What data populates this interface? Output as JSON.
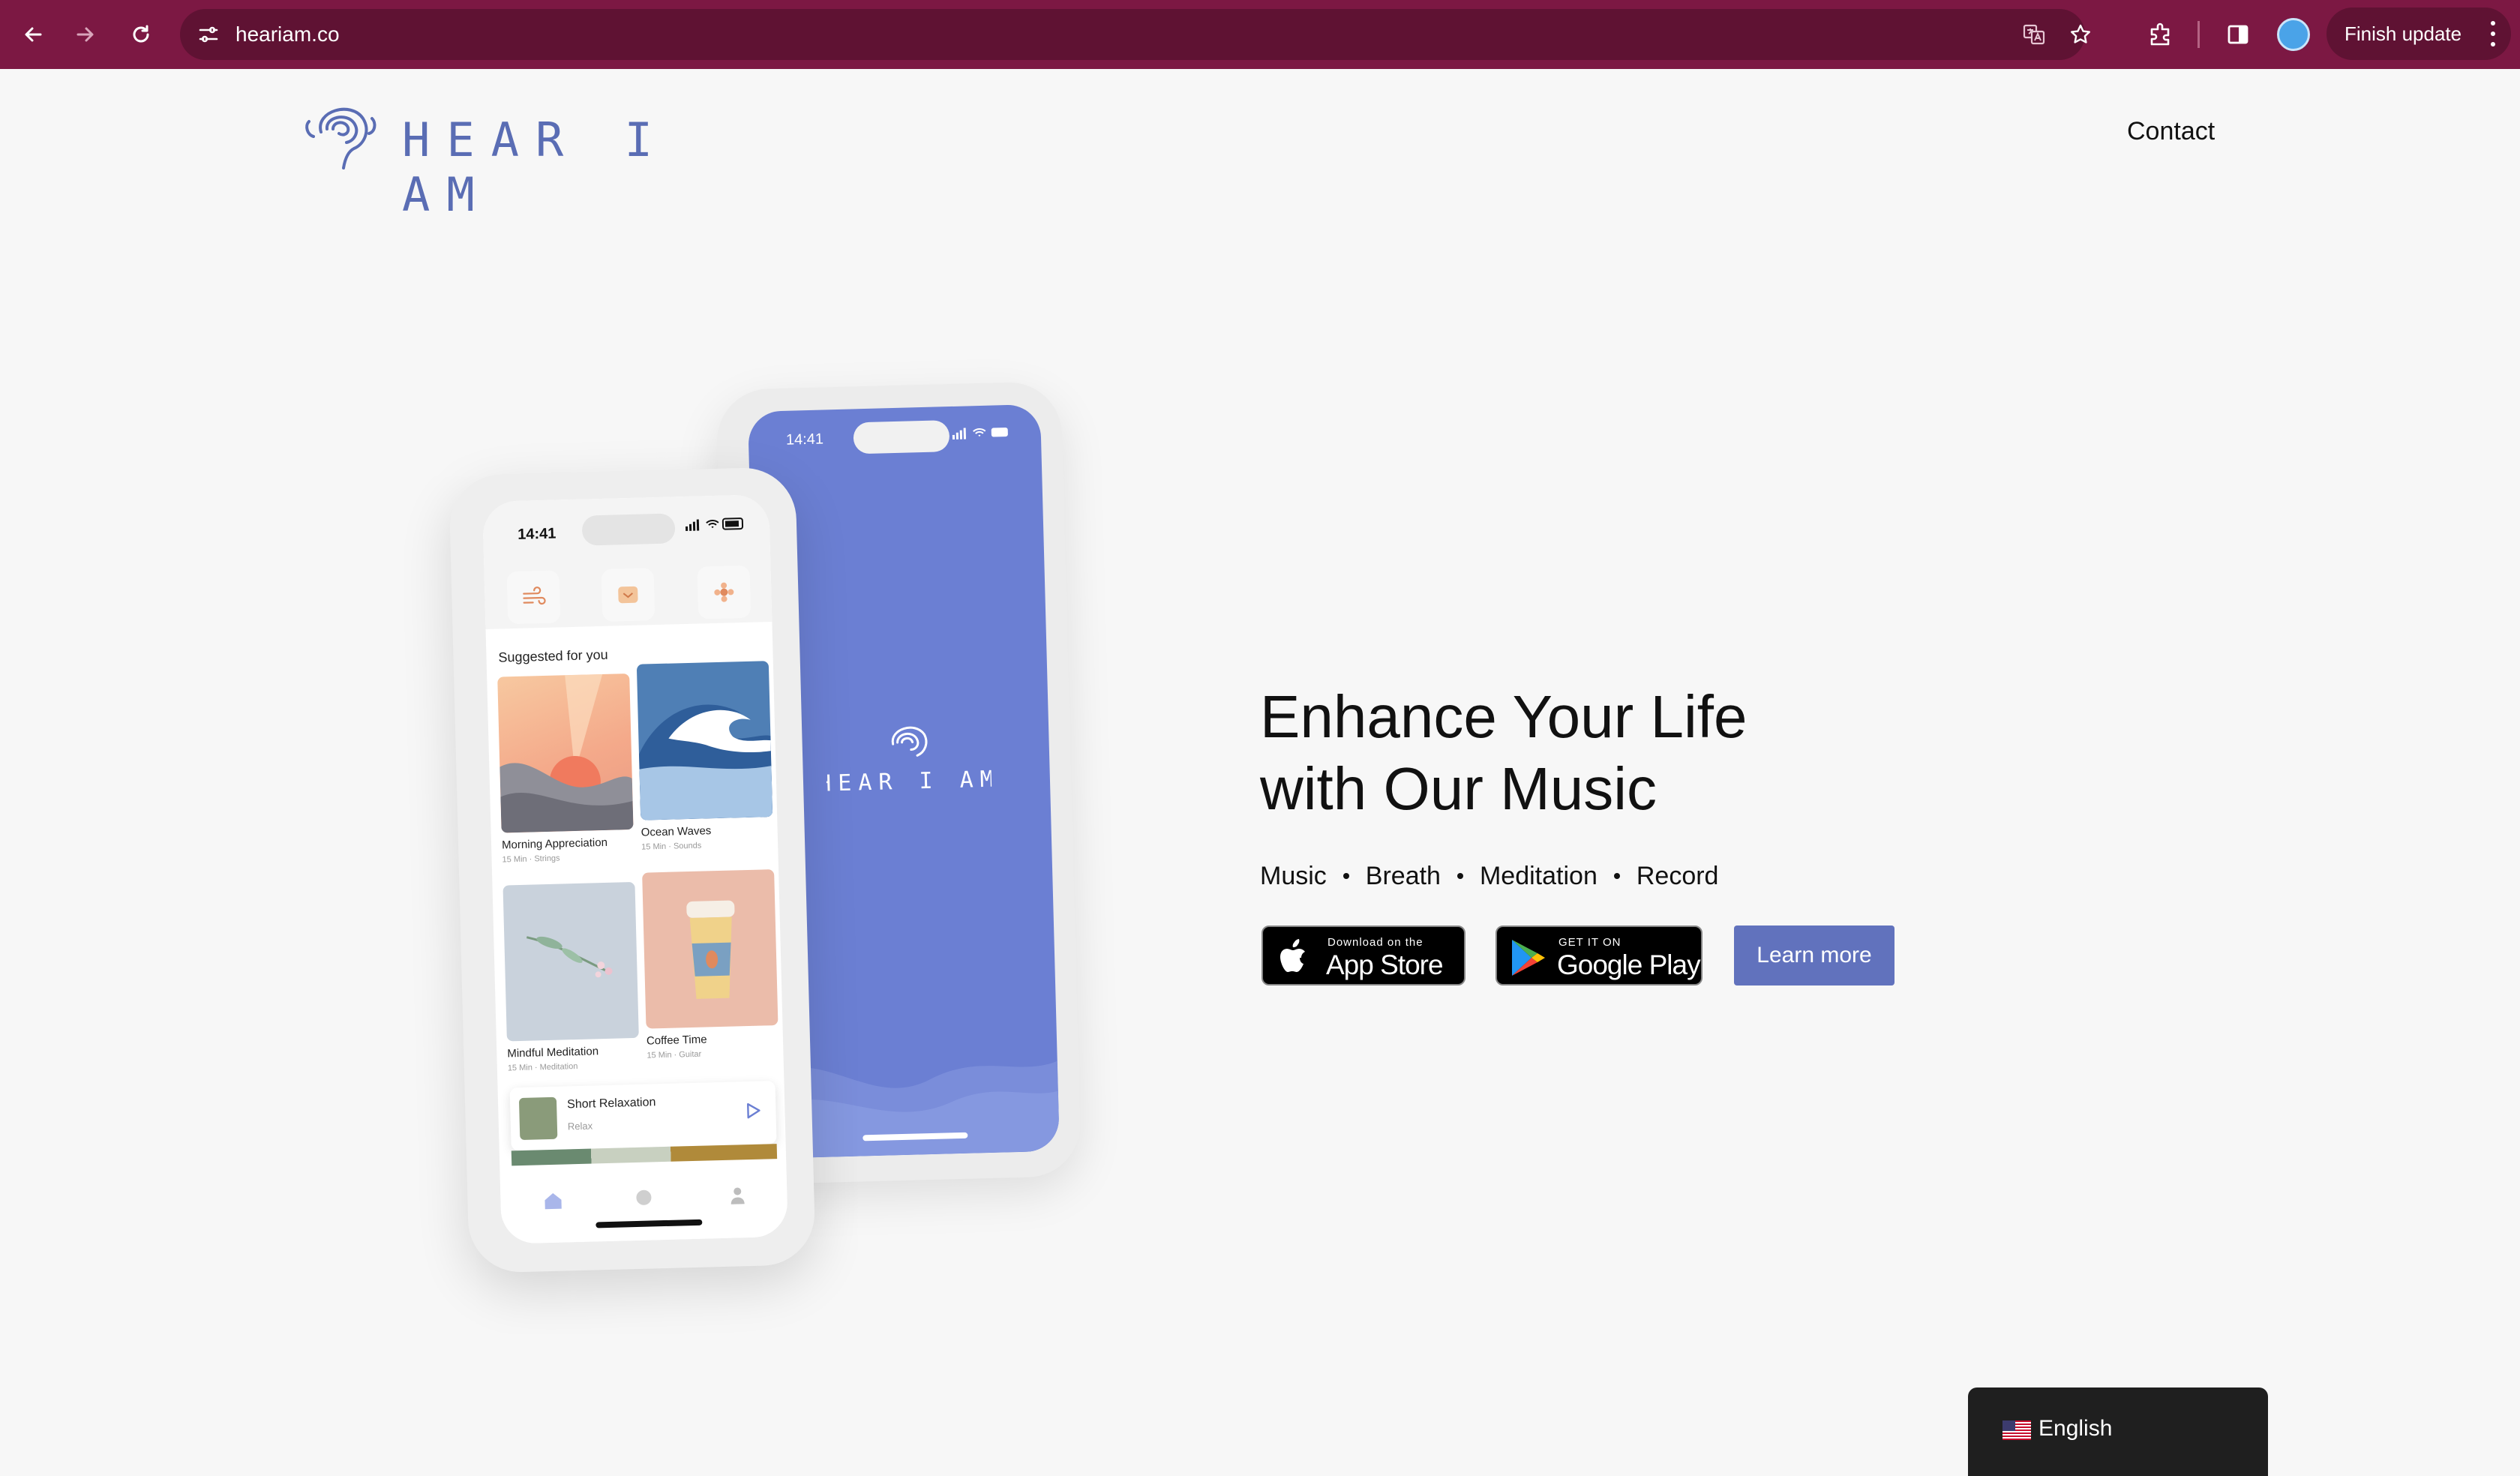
{
  "browser": {
    "url": "heariam.co",
    "finish_update_label": "Finish update"
  },
  "header": {
    "logo_text": "HEAR I AM",
    "contact_label": "Contact"
  },
  "phone_back": {
    "time": "14:41",
    "logo_text": "HEAR I AM"
  },
  "phone_front": {
    "time": "14:41",
    "section_title": "Suggested for you",
    "cards": [
      {
        "title": "Morning Appreciation",
        "subtitle": "15 Min · Strings"
      },
      {
        "title": "Ocean Waves",
        "subtitle": "15 Min · Sounds"
      },
      {
        "title": "Mindful Meditation",
        "subtitle": "15 Min · Meditation"
      },
      {
        "title": "Coffee Time",
        "subtitle": "15 Min · Guitar"
      }
    ],
    "mini_player": {
      "title": "Short Relaxation",
      "subtitle": "Relax"
    }
  },
  "hero": {
    "title_line1": "Enhance Your Life",
    "title_line2": "with Our Music",
    "features": [
      "Music",
      "Breath",
      "Meditation",
      "Record"
    ],
    "app_store": {
      "small": "Download on the",
      "big": "App Store"
    },
    "google_play": {
      "small": "GET IT ON",
      "big": "Google Play"
    },
    "learn_more_label": "Learn more"
  },
  "language": {
    "label": "English"
  },
  "colors": {
    "chrome": "#7c1843",
    "brand": "#5a6db4",
    "phone_screen": "#6b7fd3",
    "button": "#6172bd"
  }
}
